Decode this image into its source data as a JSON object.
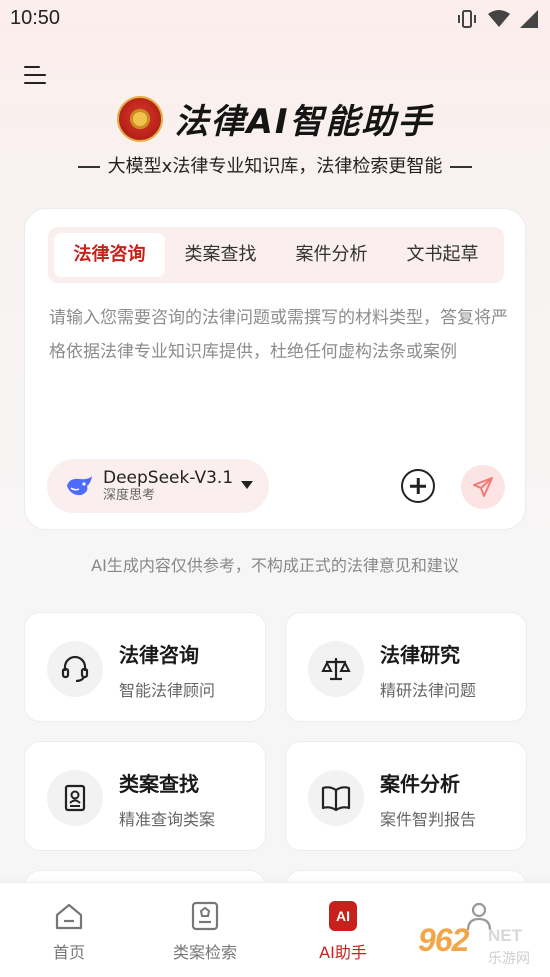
{
  "status_bar": {
    "time": "10:50"
  },
  "header": {
    "title": "法律AI智能助手",
    "tagline": "大模型x法律专业知识库，法律检索更智能"
  },
  "input_card": {
    "tabs": [
      {
        "label": "法律咨询",
        "active": true
      },
      {
        "label": "类案查找",
        "active": false
      },
      {
        "label": "案件分析",
        "active": false
      },
      {
        "label": "文书起草",
        "active": false
      }
    ],
    "placeholder": "请输入您需要咨询的法律问题或需撰写的材料类型，答复将严格依据法律专业知识库提供，杜绝任何虚构法条或案例",
    "model": {
      "name": "DeepSeek-V3.1",
      "mode": "深度思考"
    }
  },
  "disclaimer": "AI生成内容仅供参考，不构成正式的法律意见和建议",
  "features": [
    {
      "title": "法律咨询",
      "subtitle": "智能法律顾问",
      "icon": "headset-icon"
    },
    {
      "title": "法律研究",
      "subtitle": "精研法律问题",
      "icon": "scale-icon"
    },
    {
      "title": "类案查找",
      "subtitle": "精准查询类案",
      "icon": "case-file-icon"
    },
    {
      "title": "案件分析",
      "subtitle": "案件智判报告",
      "icon": "book-icon"
    }
  ],
  "bottom_nav": [
    {
      "label": "首页",
      "icon": "home-icon",
      "active": false
    },
    {
      "label": "类案检索",
      "icon": "case-search-icon",
      "active": false
    },
    {
      "label": "AI助手",
      "icon": "ai-icon",
      "badge": "AI",
      "active": true
    },
    {
      "label": "",
      "icon": "profile-icon",
      "active": false
    }
  ],
  "watermark": {
    "number": "962",
    "domain": "NET",
    "text": "乐游网"
  },
  "colors": {
    "accent": "#c8211b",
    "tab_bg": "#fbeeee",
    "brand_gold": "#e3b04a"
  }
}
